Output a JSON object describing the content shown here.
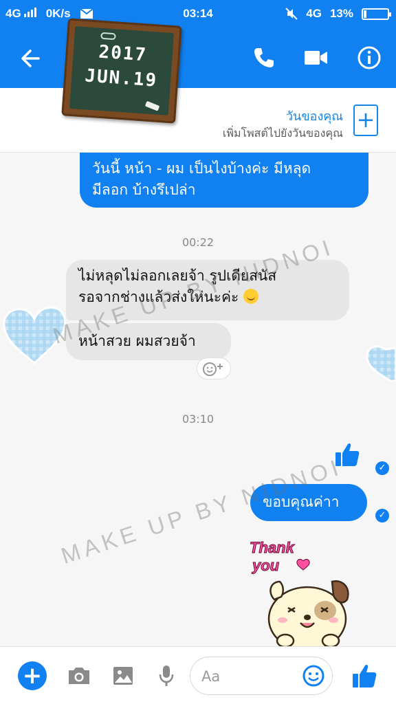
{
  "status_bar": {
    "network": "4G",
    "speed": "0K/s",
    "time": "03:14",
    "network_right": "4G",
    "battery": "13%",
    "battery_level": 0.13
  },
  "header": {
    "board_line1": "2017",
    "board_line2": "JUN.19",
    "back_icon": "arrow-left-icon",
    "call_icon": "phone-icon",
    "video_icon": "video-camera-icon",
    "info_icon": "info-icon"
  },
  "your_day": {
    "title": "วันของคุณ",
    "subtitle": "เพิ่มโพสต์ไปยังวันของคุณ",
    "add_icon": "+"
  },
  "messages": [
    {
      "direction": "out",
      "line1": "วันนี้ หน้า - ผม เป็นไงบ้างค่ะ มีหลุด",
      "line2": "มีลอก บ้างรึเปล่า"
    },
    {
      "direction": "in",
      "line1": "ไม่หลุดไม่ลอกเลยจ้า  รูปเดียสนัส",
      "line2": "รอจากช่างแล้วส่งให่นะค่ะ"
    },
    {
      "direction": "in",
      "line1": "หน้าสวย ผมสวยจ้า"
    },
    {
      "direction": "out",
      "line1": "ขอบคุณค่าา"
    }
  ],
  "timestamps": [
    "00:22",
    "03:10"
  ],
  "watermark": [
    "MAKE UP BY NIDNOI",
    "MAKE UP BY NIDNOI"
  ],
  "sticker": {
    "line1": "Thank",
    "line2": "you"
  },
  "composer": {
    "placeholder": "Aa",
    "plus": "+"
  },
  "colors": {
    "brand": "#1181f2",
    "incoming_bubble": "#e6e6e6"
  }
}
